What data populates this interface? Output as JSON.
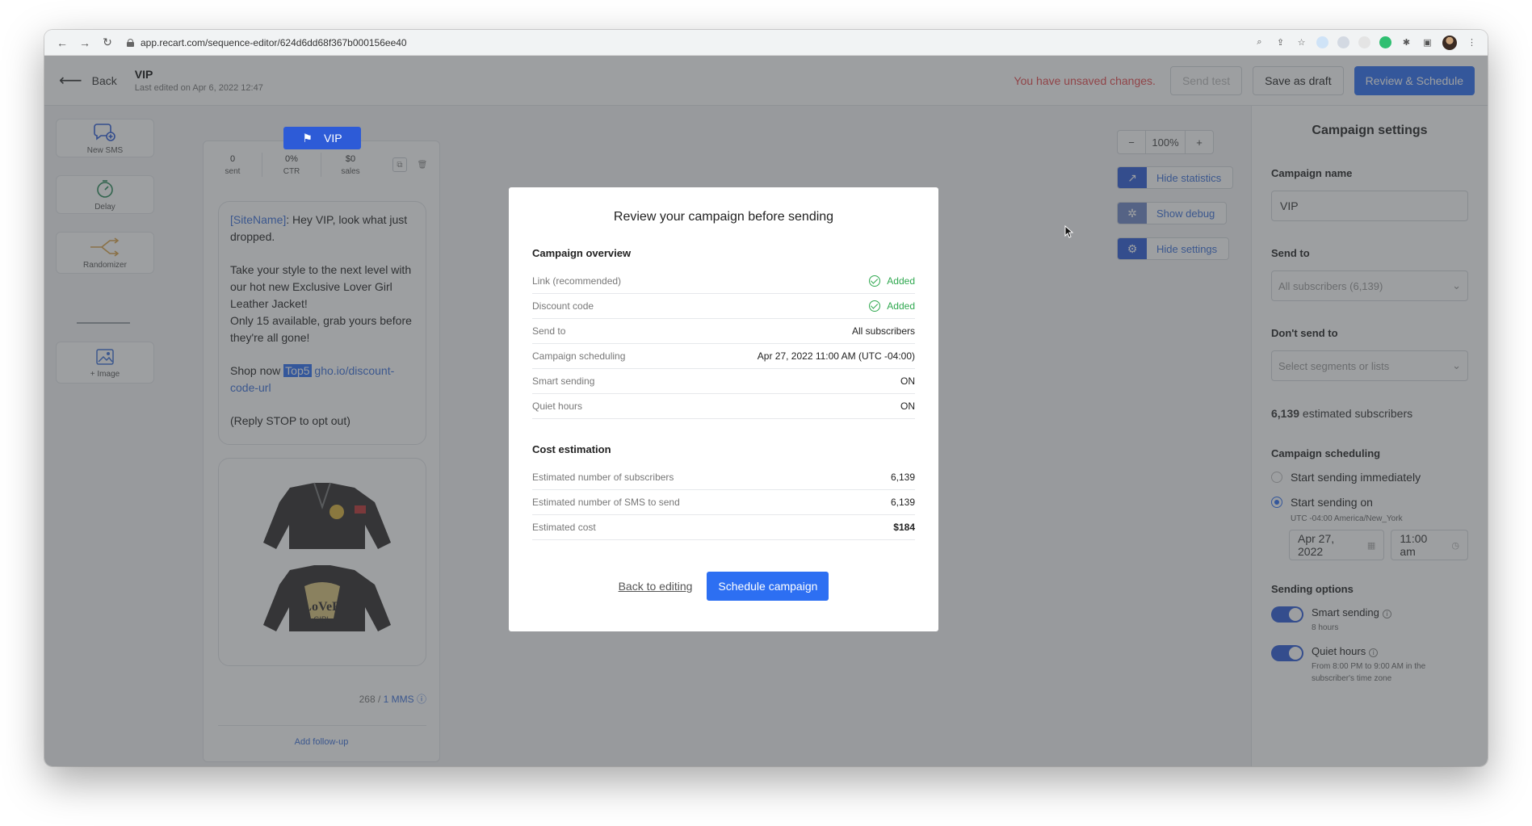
{
  "browser": {
    "url": "app.recart.com/sequence-editor/624d6dd68f367b000156ee40"
  },
  "header": {
    "back_label": "Back",
    "title": "VIP",
    "subtitle": "Last edited on Apr 6, 2022 12:47",
    "unsaved": "You have unsaved changes.",
    "send_test": "Send test",
    "save_draft": "Save as draft",
    "review": "Review & Schedule"
  },
  "tools": {
    "new_sms": "New SMS",
    "delay": "Delay",
    "randomizer": "Randomizer",
    "image": "+ Image"
  },
  "flow": {
    "flag": "VIP",
    "stats": [
      {
        "value": "0",
        "label": "sent"
      },
      {
        "value": "0%",
        "label": "CTR"
      },
      {
        "value": "$0",
        "label": "sales"
      }
    ],
    "message": {
      "site_tag": "[SiteName]",
      "line1": ": Hey VIP, look what just dropped.",
      "line2": "Take your style to the next level with our hot new Exclusive Lover Girl Leather Jacket!",
      "line3": "Only 15 available, grab yours before they're all gone!",
      "shop_now": "Shop now ",
      "code": "Top5",
      "link": "gho.io/discount-code-url",
      "stop": "(Reply STOP to opt out)"
    },
    "counter": "268 / ",
    "mms": "1 MMS",
    "followup": "Add follow-up"
  },
  "controls": {
    "zoom": "100%",
    "hide_stats": "Hide statistics",
    "show_debug": "Show debug",
    "hide_settings": "Hide settings"
  },
  "settings": {
    "title": "Campaign settings",
    "name_label": "Campaign name",
    "name_value": "VIP",
    "send_to_label": "Send to",
    "send_to_value": "All subscribers (6,139)",
    "dont_send_label": "Don't send to",
    "dont_send_placeholder": "Select segments or lists",
    "est_count": "6,139",
    "est_label": " estimated subscribers",
    "scheduling_label": "Campaign scheduling",
    "opt_immediately": "Start sending immediately",
    "opt_on": "Start sending on",
    "timezone": "UTC -04:00 America/New_York",
    "date": "Apr 27, 2022",
    "time": "11:00 am",
    "sending_options": "Sending options",
    "smart_sending": "Smart sending",
    "smart_sub": "8 hours",
    "quiet_hours": "Quiet hours",
    "quiet_sub": "From 8:00 PM to 9:00 AM in the subscriber's time zone"
  },
  "modal": {
    "title": "Review your campaign before sending",
    "overview_title": "Campaign overview",
    "overview": [
      {
        "label": "Link (recommended)",
        "value": "Added"
      },
      {
        "label": "Discount code",
        "value": "Added"
      },
      {
        "label": "Send to",
        "value": "All subscribers"
      },
      {
        "label": "Campaign scheduling",
        "value": "Apr 27, 2022 11:00 AM (UTC -04:00)"
      },
      {
        "label": "Smart sending",
        "value": "ON"
      },
      {
        "label": "Quiet hours",
        "value": "ON"
      }
    ],
    "cost_title": "Cost estimation",
    "cost": [
      {
        "label": "Estimated number of subscribers",
        "value": "6,139"
      },
      {
        "label": "Estimated number of SMS to send",
        "value": "6,139"
      },
      {
        "label": "Estimated cost",
        "value": "$184"
      }
    ],
    "back": "Back to editing",
    "schedule": "Schedule campaign"
  },
  "colors": {
    "primary": "#2d6ff2",
    "flag": "#2d5bd7",
    "success": "#2fa84f",
    "warning_text": "#e5484d"
  }
}
